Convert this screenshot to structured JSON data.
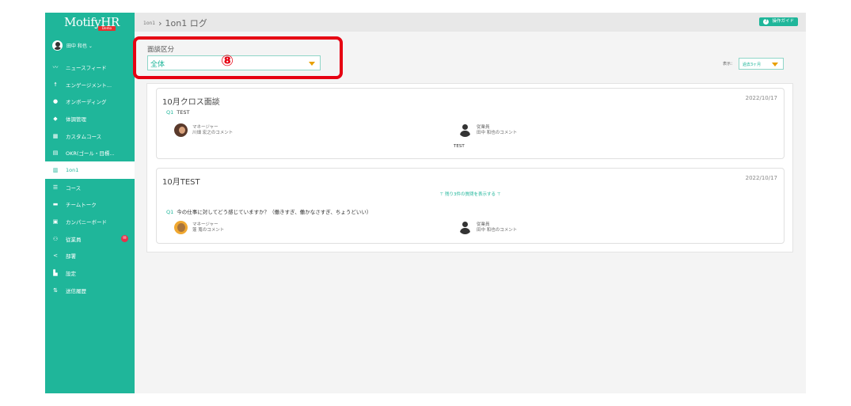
{
  "app": {
    "brand": "MotifyHR",
    "brand_badge": "Demo",
    "user_name": "田中 和也 ⌄"
  },
  "sidebar": {
    "items": [
      {
        "icon": "trend-line-icon",
        "glyph": "〰",
        "label": "ニュースフィード"
      },
      {
        "icon": "person-icon",
        "glyph": "☨",
        "label": "エンゲージメント..."
      },
      {
        "icon": "check-circle-icon",
        "glyph": "●",
        "label": "オンボーディング"
      },
      {
        "icon": "tag-icon",
        "glyph": "◆",
        "label": "体調管理"
      },
      {
        "icon": "grid-icon",
        "glyph": "▦",
        "label": "カスタムコース"
      },
      {
        "icon": "document-icon",
        "glyph": "▤",
        "label": "OKR(ゴール・目標..."
      },
      {
        "icon": "map-icon",
        "glyph": "▥",
        "label": "1on1",
        "active": true
      },
      {
        "icon": "list-icon",
        "glyph": "☰",
        "label": "コース"
      },
      {
        "icon": "chat-icon",
        "glyph": "▬",
        "label": "チームトーク"
      },
      {
        "icon": "board-icon",
        "glyph": "▣",
        "label": "カンパニーボード"
      },
      {
        "icon": "people-icon",
        "glyph": "⚇",
        "label": "従業員",
        "badge": "✉"
      },
      {
        "icon": "share-icon",
        "glyph": "<",
        "label": "部署"
      },
      {
        "icon": "bar-chart-icon",
        "glyph": "▙",
        "label": "設定"
      },
      {
        "icon": "sort-icon",
        "glyph": "⇅",
        "label": "送信履歴"
      }
    ]
  },
  "topbar": {
    "crumb_small": "1on1",
    "crumb_sep": "›",
    "crumb_big": "1on1 ログ",
    "guide_label": "操作ガイド",
    "guide_icon": "?"
  },
  "filter": {
    "label": "面談区分",
    "value": "全体",
    "marker": "⑧",
    "period_label": "表示：",
    "period_value": "過去3ヶ月"
  },
  "cards": [
    {
      "title": "10月クロス面談",
      "date": "2022/10/17",
      "question_no": "Q1",
      "question": "TEST",
      "manager_role": "マネージャー",
      "manager_comment": "川畑 宏之のコメント",
      "employee_role": "従業員",
      "employee_comment": "田中 和也のコメント",
      "answer": "TEST"
    },
    {
      "title": "10月TEST",
      "date": "2022/10/17",
      "show_more": "⊤ 残り3件の質問を表示する ⊤",
      "question_no": "Q1",
      "question": "今の仕事に対してどう感じていますか？（働きすぎ、働かなさすぎ、ちょうどいい）",
      "manager_role": "マネージャー",
      "manager_comment": "蓬 蒐のコメント",
      "employee_role": "従業員",
      "employee_comment": "田中 和也のコメント"
    }
  ],
  "colors": {
    "accent": "#1fb69a",
    "highlight": "#e60012",
    "dropdown_arrow": "#e8a000"
  }
}
